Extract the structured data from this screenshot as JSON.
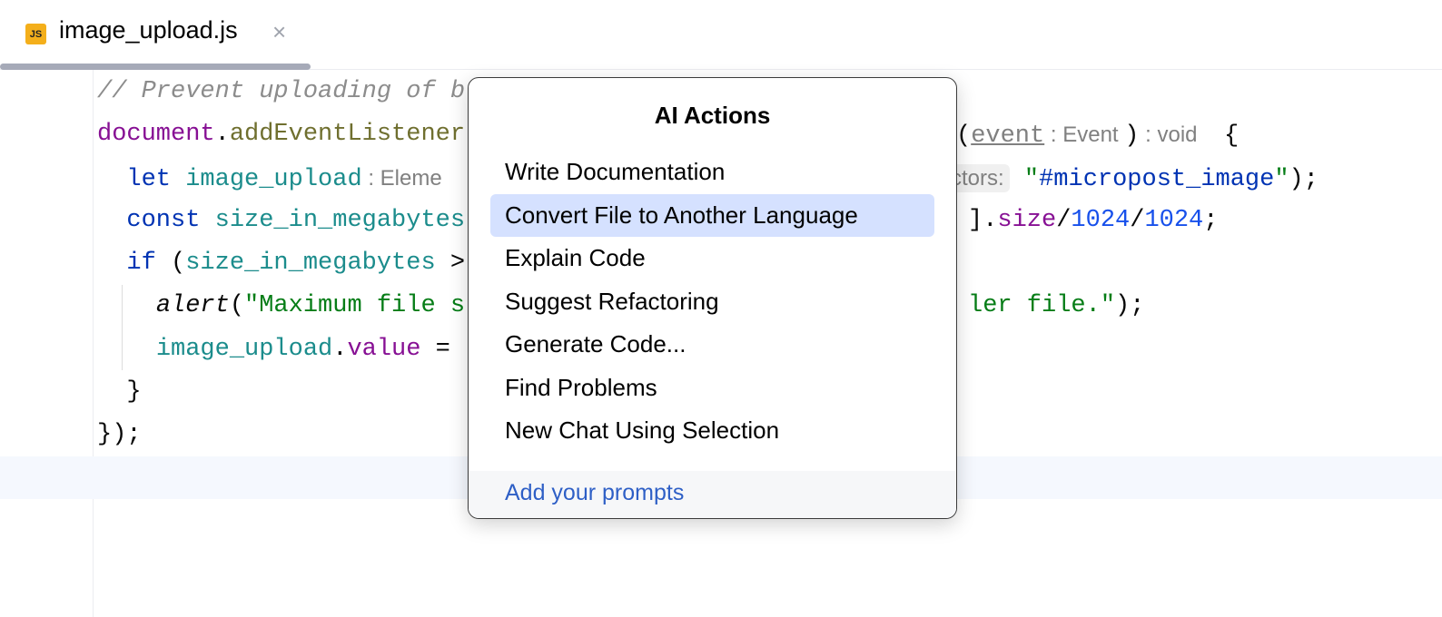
{
  "tab": {
    "icon_label": "JS",
    "filename": "image_upload.js",
    "close": "×"
  },
  "code": {
    "lines": [
      {
        "left": [
          {
            "t": "// Prevent uploading of b",
            "c": "cm"
          }
        ],
        "right": []
      },
      {
        "left": [
          {
            "t": "document",
            "c": "glob"
          },
          {
            "t": ".",
            "c": "pl"
          },
          {
            "t": "addEventListener",
            "c": "fn"
          }
        ],
        "right": [
          {
            "t": "(",
            "c": "pl"
          },
          {
            "t": "event",
            "c": "ul"
          },
          {
            "t": " : Event ",
            "c": "hint"
          },
          {
            "t": ")",
            "c": "pl"
          },
          {
            "t": " : void  ",
            "c": "hint"
          },
          {
            "t": " {",
            "c": "pl"
          }
        ]
      },
      {
        "left": [
          {
            "t": "  let ",
            "c": "kw"
          },
          {
            "t": "image_upload",
            "c": "id"
          },
          {
            "t": " : Eleme",
            "c": "hint"
          }
        ],
        "right": [
          {
            "t": "ctors:",
            "c": "chip"
          },
          {
            "t": " \"",
            "c": "str"
          },
          {
            "t": "#micropost_image",
            "c": "kw"
          },
          {
            "t": "\"",
            "c": "str"
          },
          {
            "t": ");",
            "c": "pl"
          }
        ]
      },
      {
        "left": [
          {
            "t": "  const ",
            "c": "kw"
          },
          {
            "t": "size_in_megabytes",
            "c": "id"
          }
        ],
        "right": [
          {
            "t": "].",
            "c": "pl"
          },
          {
            "t": "size",
            "c": "prop"
          },
          {
            "t": "/",
            "c": "pl"
          },
          {
            "t": "1024",
            "c": "num"
          },
          {
            "t": "/",
            "c": "pl"
          },
          {
            "t": "1024",
            "c": "num"
          },
          {
            "t": ";",
            "c": "pl"
          }
        ]
      },
      {
        "left": [
          {
            "t": "  if ",
            "c": "kw"
          },
          {
            "t": "(",
            "c": "pl"
          },
          {
            "t": "size_in_megabytes",
            "c": "id"
          },
          {
            "t": " >",
            "c": "pl"
          }
        ],
        "right": []
      },
      {
        "left": [
          {
            "t": "    ",
            "c": "pl"
          },
          {
            "t": "alert",
            "c": "it"
          },
          {
            "t": "(",
            "c": "pl"
          },
          {
            "t": "\"Maximum file s",
            "c": "str"
          }
        ],
        "right": [
          {
            "t": "ler file.\"",
            "c": "str"
          },
          {
            "t": ");",
            "c": "pl"
          }
        ]
      },
      {
        "left": [
          {
            "t": "    ",
            "c": "pl"
          },
          {
            "t": "image_upload",
            "c": "id"
          },
          {
            "t": ".",
            "c": "pl"
          },
          {
            "t": "value",
            "c": "prop"
          },
          {
            "t": " =",
            "c": "pl"
          }
        ],
        "right": []
      },
      {
        "left": [
          {
            "t": "  }",
            "c": "pl"
          }
        ],
        "right": []
      },
      {
        "left": [
          {
            "t": "});",
            "c": "pl"
          }
        ],
        "right": []
      }
    ]
  },
  "popup": {
    "title": "AI Actions",
    "items": [
      "Write Documentation",
      "Convert File to Another Language",
      "Explain Code",
      "Suggest Refactoring",
      "Generate Code...",
      "Find Problems",
      "New Chat Using Selection"
    ],
    "selected_index": 1,
    "footer_link": "Add your prompts"
  },
  "colors": {
    "accent": "#2e5fc6",
    "selection": "#d5e1ff",
    "js_badge": "#f4af1b"
  }
}
